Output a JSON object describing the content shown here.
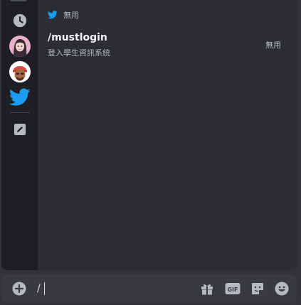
{
  "rail": {
    "items": [
      {
        "name": "recent-icon"
      },
      {
        "name": "user-avatar-1"
      },
      {
        "name": "user-avatar-2"
      },
      {
        "name": "twitter-app-icon"
      },
      {
        "name": "edit-icon"
      }
    ]
  },
  "section": {
    "title": "無用"
  },
  "command": {
    "name": "/mustlogin",
    "description": "登入學生資訊系統",
    "app": "無用"
  },
  "composer": {
    "input_value": "/",
    "icons": [
      "add-icon",
      "gift-icon",
      "gif-icon",
      "sticker-icon",
      "emoji-icon"
    ]
  },
  "colors": {
    "background": "#313338",
    "panel": "#2b2d31",
    "rail": "#1e1f22",
    "composer": "#383a40",
    "twitter_blue": "#1d9bf0",
    "icon_gray": "#b5bac1"
  }
}
